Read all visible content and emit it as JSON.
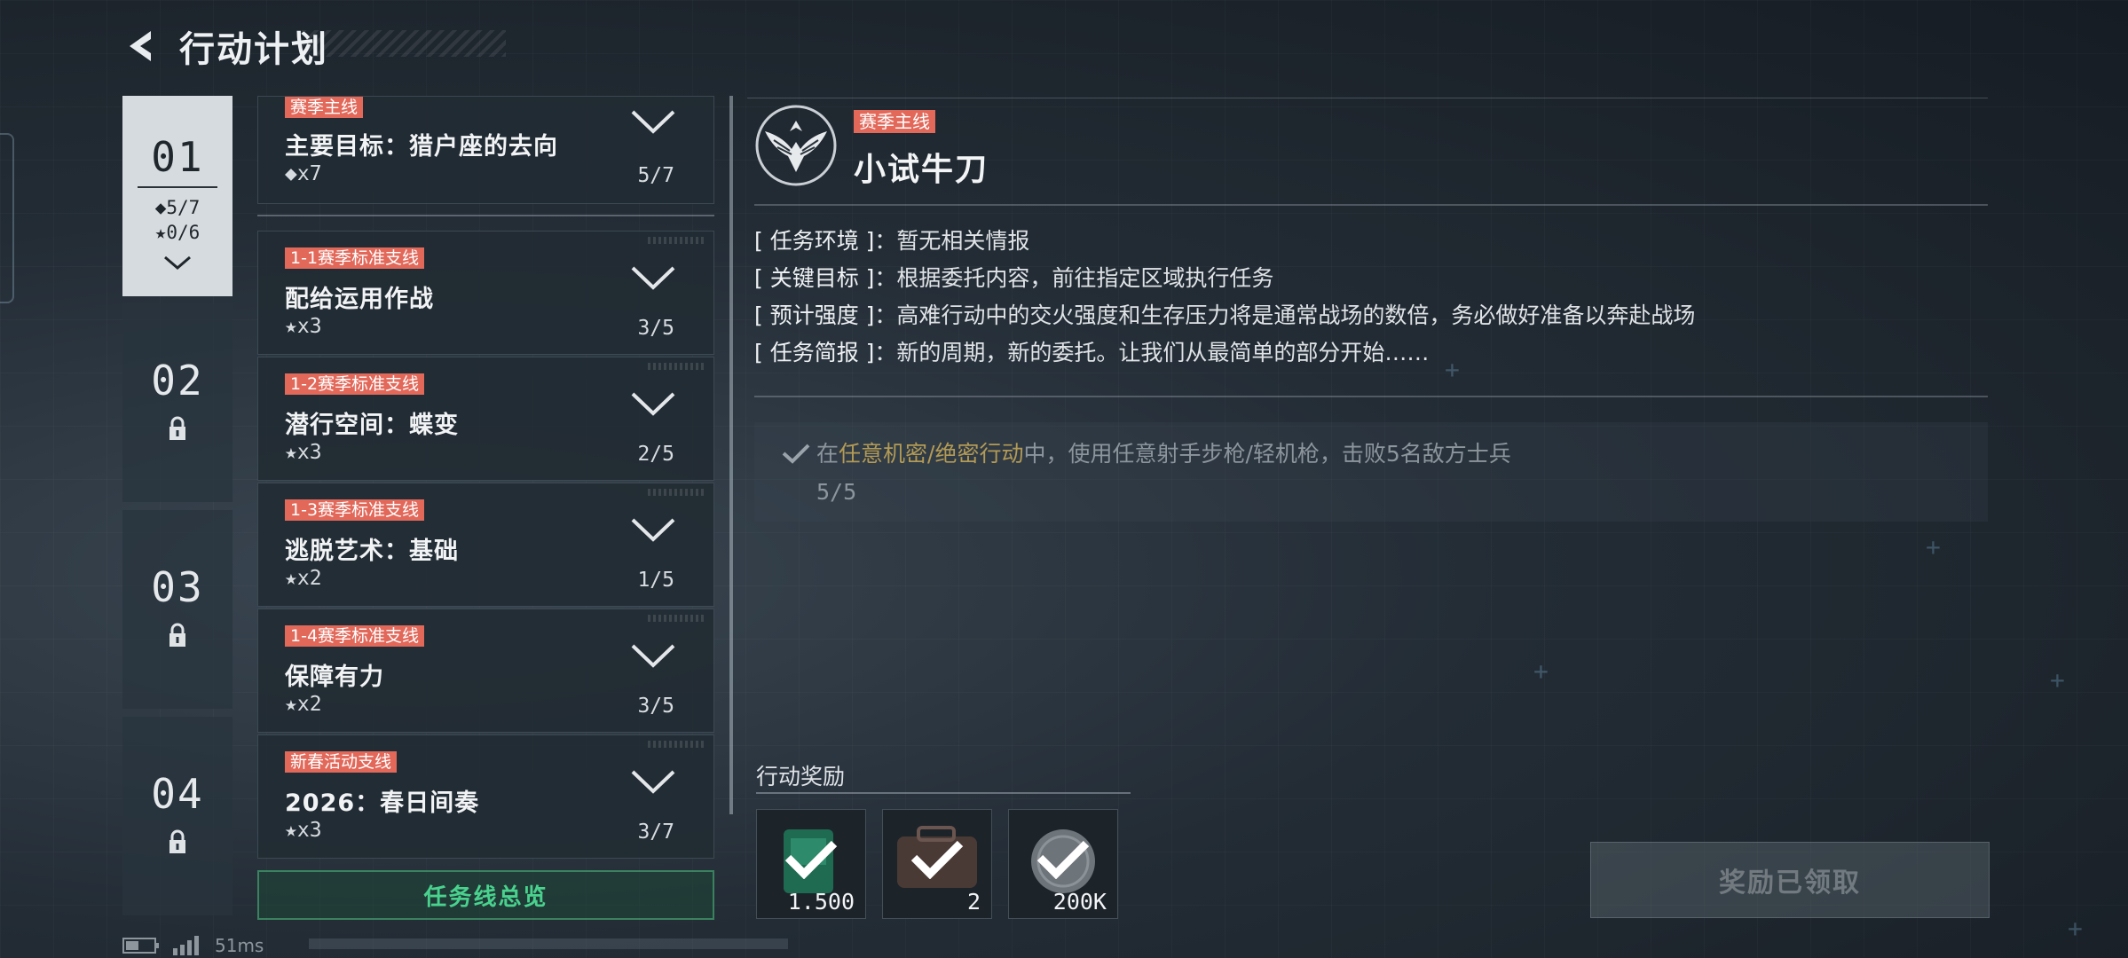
{
  "header": {
    "title": "行动计划"
  },
  "chapters": [
    {
      "num": "01",
      "diamond": "◆5/7",
      "star": "★0/6"
    },
    {
      "num": "02"
    },
    {
      "num": "03"
    },
    {
      "num": "04"
    }
  ],
  "missions": [
    {
      "tag": "赛季主线",
      "title": "主要目标：猎户座的去向",
      "reward": "◆x7",
      "progress": "5/7"
    },
    {
      "tag": "1-1赛季标准支线",
      "title": "配给运用作战",
      "reward": "★x3",
      "progress": "3/5"
    },
    {
      "tag": "1-2赛季标准支线",
      "title": "潜行空间：蝶变",
      "reward": "★x3",
      "progress": "2/5"
    },
    {
      "tag": "1-3赛季标准支线",
      "title": "逃脱艺术：基础",
      "reward": "★x2",
      "progress": "1/5"
    },
    {
      "tag": "1-4赛季标准支线",
      "title": "保障有力",
      "reward": "★x2",
      "progress": "3/5"
    },
    {
      "tag": "新春活动支线",
      "title": "2026：春日间奏",
      "reward": "★x3",
      "progress": "3/7"
    }
  ],
  "overview_button": "任务线总览",
  "detail": {
    "tag": "赛季主线",
    "title": "小试牛刀",
    "info": [
      {
        "label": "[ 任务环境 ]",
        "value": "：暂无相关情报"
      },
      {
        "label": "[ 关键目标 ]",
        "value": "：根据委托内容，前往指定区域执行任务"
      },
      {
        "label": "[ 预计强度 ]",
        "value": "：高难行动中的交火强度和生存压力将是通常战场的数倍，务必做好准备以奔赴战场"
      },
      {
        "label": "[ 任务简报 ]",
        "value": "：新的周期，新的委托。让我们从最简单的部分开始……"
      }
    ],
    "objective": {
      "prefix": "在",
      "highlight": "任意机密/绝密行动",
      "suffix": "中，使用任意射手步枪/轻机枪，击败5名敌方士兵",
      "progress": "5/5"
    }
  },
  "rewards": {
    "label": "行动奖励",
    "items": [
      {
        "qty": "1.500",
        "icon": "ticket-icon"
      },
      {
        "qty": "2",
        "icon": "case-icon"
      },
      {
        "qty": "200K",
        "icon": "coin-icon"
      }
    ]
  },
  "claim_button": "奖励已领取",
  "status": {
    "ping": "51ms"
  },
  "colors": {
    "tag": "#e2685a",
    "accent_green": "#49d28e",
    "highlight": "#b39a55"
  }
}
